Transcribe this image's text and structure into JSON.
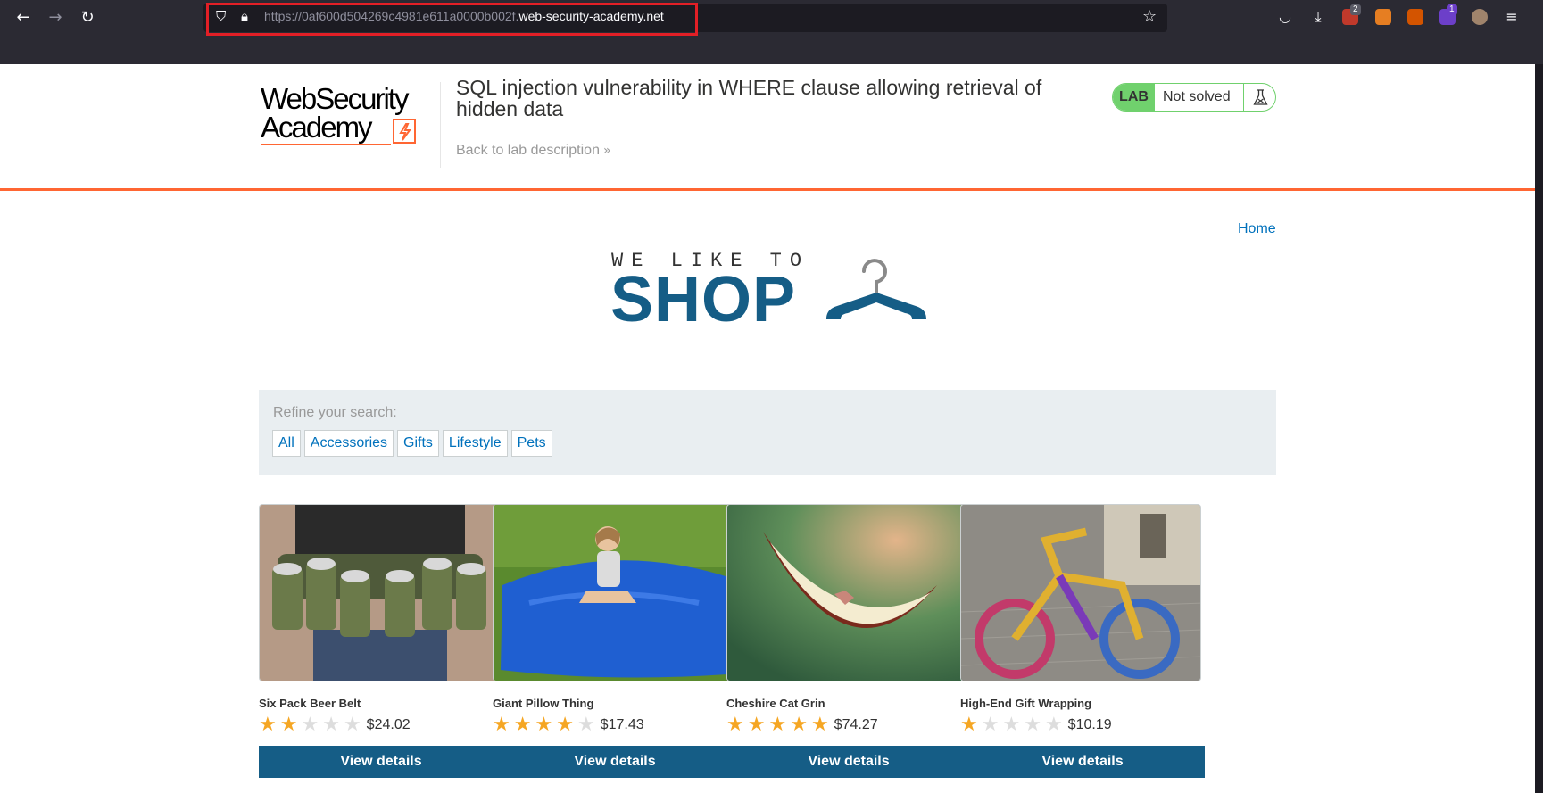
{
  "browser": {
    "url_prefix": "https://0af600d504269c4981e611a0000b002f.",
    "url_domain": "web-security-academy.net",
    "back_icon": "arrow-left-icon",
    "forward_icon": "arrow-right-icon",
    "reload_icon": "reload-icon",
    "ext_badge_1": "2",
    "ext_badge_2": "1"
  },
  "header": {
    "logo_line1": "WebSecurity",
    "logo_line2": "Academy",
    "lab_title": "SQL injection vulnerability in WHERE clause allowing retrieval of hidden data",
    "back_link": "Back to lab description",
    "back_chevron": "»",
    "lab_badge": "LAB",
    "lab_status": "Not solved"
  },
  "nav": {
    "home": "Home"
  },
  "shop_logo": {
    "tagline": "WE LIKE TO",
    "word": "SHOP"
  },
  "filter": {
    "label": "Refine your search:",
    "categories": [
      "All",
      "Accessories",
      "Gifts",
      "Lifestyle",
      "Pets"
    ]
  },
  "products": [
    {
      "name": "Six Pack Beer Belt",
      "rating": 2,
      "price": "$24.02",
      "button": "View details"
    },
    {
      "name": "Giant Pillow Thing",
      "rating": 4,
      "price": "$17.43",
      "button": "View details"
    },
    {
      "name": "Cheshire Cat Grin",
      "rating": 5,
      "price": "$74.27",
      "button": "View details"
    },
    {
      "name": "High-End Gift Wrapping",
      "rating": 1,
      "price": "$10.19",
      "button": "View details"
    }
  ],
  "colors": {
    "accent_orange": "#ff6633",
    "shop_blue": "#155d86",
    "link_blue": "#0071bc",
    "lab_green": "#70d16d",
    "star_gold": "#f5a623"
  }
}
